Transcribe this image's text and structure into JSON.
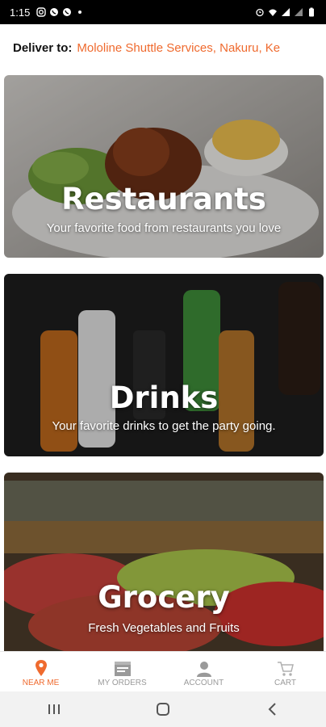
{
  "status_bar": {
    "time": "1:15",
    "left_icons": [
      "instagram-icon",
      "whatsapp-icon",
      "whatsapp-icon",
      "dot-icon"
    ],
    "right_icons": [
      "alarm-icon",
      "wifi-icon",
      "signal-icon",
      "signal-icon",
      "battery-icon"
    ]
  },
  "deliver": {
    "label": "Deliver to:",
    "location": "Mololine Shuttle Services, Nakuru, Ke"
  },
  "categories": [
    {
      "title": "Restaurants",
      "subtitle": "Your favorite food from restaurants you love"
    },
    {
      "title": "Drinks",
      "subtitle": "Your favorite drinks to get the party going."
    },
    {
      "title": "Grocery",
      "subtitle": "Fresh Vegetables and Fruits"
    }
  ],
  "bottom_nav": {
    "items": [
      {
        "label": "NEAR ME",
        "icon": "location-pin-icon",
        "active": true
      },
      {
        "label": "MY ORDERS",
        "icon": "orders-icon",
        "active": false
      },
      {
        "label": "ACCOUNT",
        "icon": "person-icon",
        "active": false
      },
      {
        "label": "CART",
        "icon": "cart-icon",
        "active": false
      }
    ]
  },
  "colors": {
    "accent": "#ef6a2e",
    "inactive": "#9a9a9a"
  }
}
